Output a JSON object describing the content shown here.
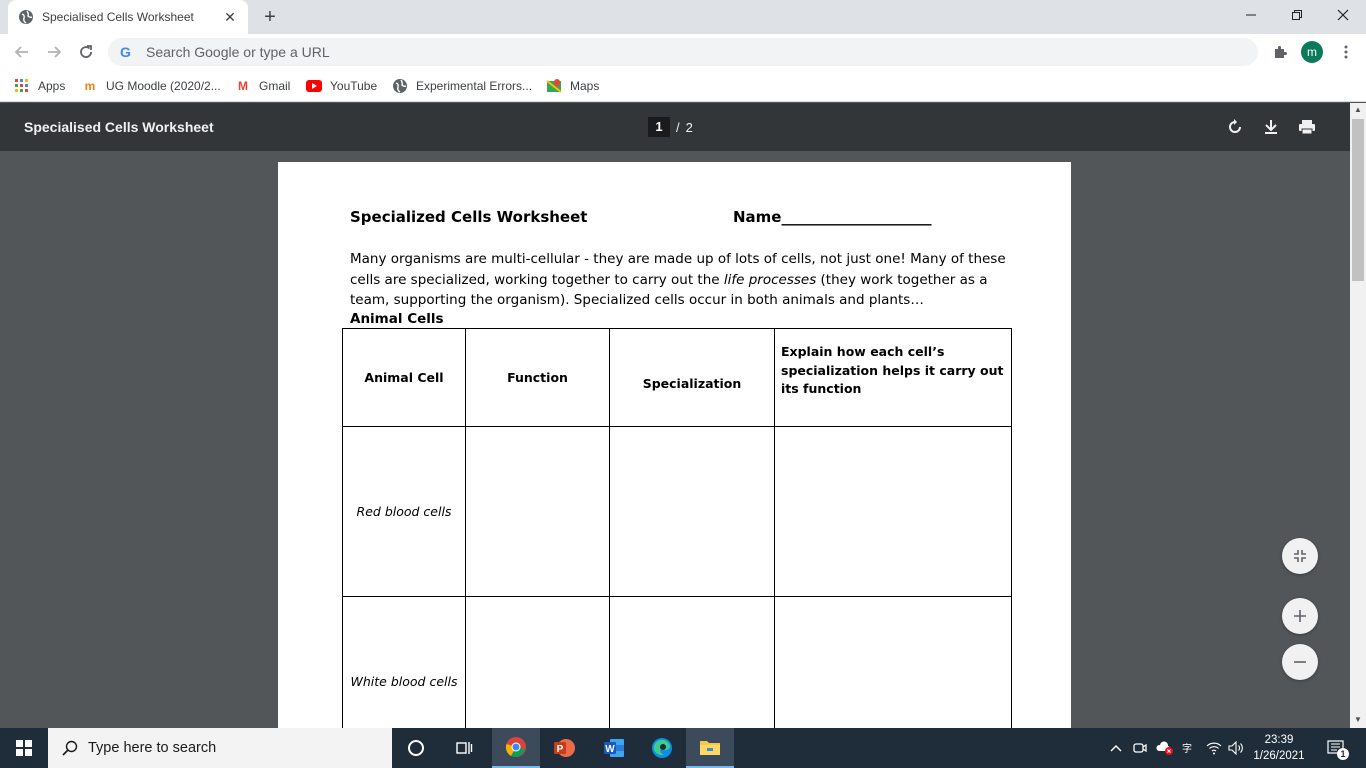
{
  "browser": {
    "tab": {
      "title": "Specialised Cells Worksheet",
      "close": "✕"
    },
    "new_tab": "+",
    "window_controls": {
      "minimize": "—",
      "restore": "❐",
      "close": "✕"
    },
    "omnibox": {
      "placeholder": "Search Google or type a URL"
    },
    "profile_initial": "m",
    "bookmarks": [
      {
        "label": "Apps",
        "icon": "apps-grid-icon"
      },
      {
        "label": "UG Moodle (2020/2...",
        "icon": "moodle-icon"
      },
      {
        "label": "Gmail",
        "icon": "gmail-icon"
      },
      {
        "label": "YouTube",
        "icon": "youtube-icon"
      },
      {
        "label": "Experimental Errors...",
        "icon": "globe-icon"
      },
      {
        "label": "Maps",
        "icon": "maps-icon"
      }
    ]
  },
  "pdf": {
    "title": "Specialised Cells Worksheet",
    "current_page": "1",
    "separator": "/",
    "total_pages": "2"
  },
  "worksheet": {
    "title": "Specialized Cells Worksheet",
    "name_line": "Name____________________",
    "intro_part1": "Many organisms are multi-cellular - they are made up of lots of cells, not just one! Many of these cells are specialized, working together to carry out the ",
    "intro_italic": "life processes",
    "intro_part2": " (they work together as a team, supporting the organism). Specialized cells occur in both animals and plants…",
    "section_heading": "Animal Cells",
    "table_headers": [
      "Animal Cell",
      "Function",
      "Specialization",
      "Explain how each cell’s specialization helps it carry out its function"
    ],
    "rows": [
      "Red blood cells",
      "White blood cells"
    ]
  },
  "taskbar": {
    "search_placeholder": "Type here to search",
    "time": "23:39",
    "date": "1/26/2021",
    "notification_count": "1"
  },
  "colors": {
    "pdf_toolbar": "#323639",
    "pdf_background": "#525659",
    "taskbar": "#1f2c3a",
    "tab_strip": "#dee1e6"
  }
}
